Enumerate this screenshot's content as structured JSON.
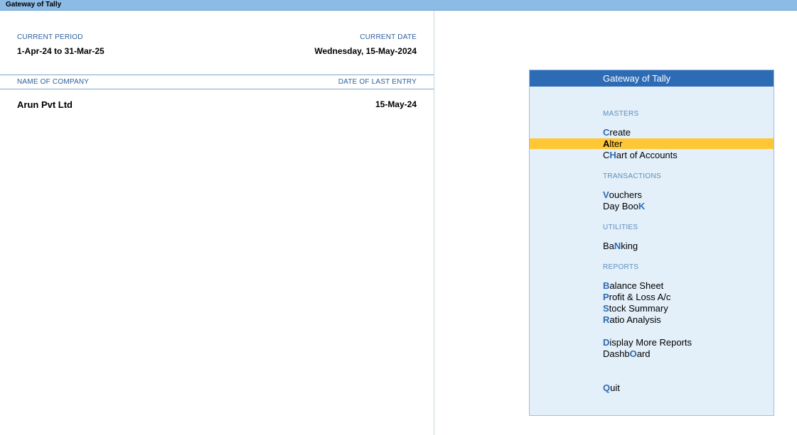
{
  "window": {
    "title": "Gateway of Tally"
  },
  "info": {
    "current_period_label": "CURRENT PERIOD",
    "current_period": "1-Apr-24 to 31-Mar-25",
    "current_date_label": "CURRENT DATE",
    "current_date": "Wednesday, 15-May-2024",
    "company_col_label": "NAME OF COMPANY",
    "last_entry_col_label": "DATE OF LAST ENTRY",
    "company_name": "Arun Pvt Ltd",
    "last_entry": "15-May-24"
  },
  "menu": {
    "title": "Gateway of Tally",
    "sections": {
      "masters": "MASTERS",
      "transactions": "TRANSACTIONS",
      "utilities": "UTILITIES",
      "reports": "REPORTS"
    },
    "items": {
      "create": {
        "pre": "",
        "key": "C",
        "post": "reate"
      },
      "alter": {
        "pre": "",
        "key": "A",
        "post": "lter",
        "selected": true
      },
      "chart": {
        "pre": "C",
        "key": "H",
        "post": "art of Accounts"
      },
      "vouchers": {
        "pre": "",
        "key": "V",
        "post": "ouchers"
      },
      "daybook": {
        "pre": "Day Boo",
        "key": "K",
        "post": ""
      },
      "banking": {
        "pre": "Ba",
        "key": "N",
        "post": "king"
      },
      "balance": {
        "pre": "",
        "key": "B",
        "post": "alance Sheet"
      },
      "pl": {
        "pre": "",
        "key": "P",
        "post": "rofit & Loss A/c"
      },
      "stock": {
        "pre": "",
        "key": "S",
        "post": "tock Summary"
      },
      "ratio": {
        "pre": "",
        "key": "R",
        "post": "atio Analysis"
      },
      "display": {
        "pre": "",
        "key": "D",
        "post": "isplay More Reports"
      },
      "dashboard": {
        "pre": "Dashb",
        "key": "O",
        "post": "ard"
      },
      "quit": {
        "pre": "",
        "key": "Q",
        "post": "uit"
      }
    },
    "colors": {
      "header": "#2e6bb5",
      "panel": "#e3eff9",
      "selected": "#ffc735",
      "hotkey": "#2d6ab7"
    }
  }
}
